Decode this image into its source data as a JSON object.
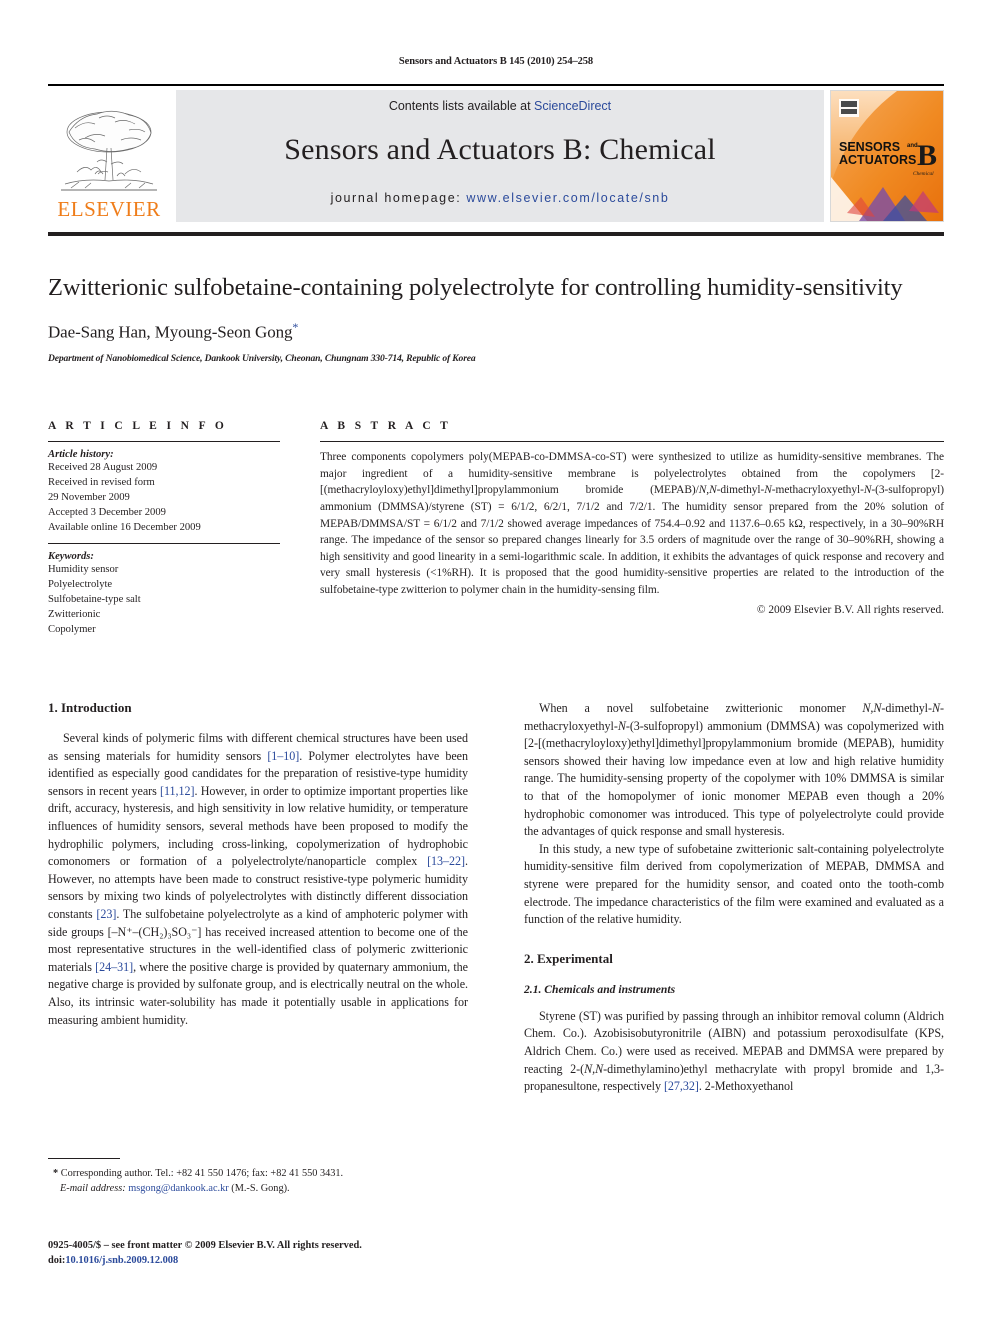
{
  "running_head": "Sensors and Actuators B 145 (2010) 254–258",
  "masthead": {
    "publisher_name": "ELSEVIER",
    "contents_prefix": "Contents lists available at ",
    "contents_link": "ScienceDirect",
    "journal_title": "Sensors and Actuators B: Chemical",
    "homepage_prefix": "journal homepage: ",
    "homepage_url": "www.elsevier.com/locate/snb",
    "cover": {
      "line1": "SENSORS",
      "line1_small": "and",
      "line2": "ACTUATORS",
      "letter": "B",
      "sublabel": "Chemical"
    }
  },
  "article": {
    "title": "Zwitterionic sulfobetaine-containing polyelectrolyte for controlling humidity-sensitivity",
    "authors": "Dae-Sang Han, Myoung-Seon Gong",
    "corresponding_marker": "*",
    "affiliation": "Department of Nanobiomedical Science, Dankook University, Cheonan, Chungnam 330-714, Republic of Korea"
  },
  "article_info": {
    "heading": "A R T I C L E    I N F O",
    "history_label": "Article history:",
    "history": [
      "Received 28 August 2009",
      "Received in revised form",
      "29 November 2009",
      "Accepted 3 December 2009",
      "Available online 16 December 2009"
    ],
    "keywords_label": "Keywords:",
    "keywords": [
      "Humidity sensor",
      "Polyelectrolyte",
      "Sulfobetaine-type salt",
      "Zwitterionic",
      "Copolymer"
    ]
  },
  "abstract": {
    "heading": "A B S T R A C T",
    "text_part1": "Three components copolymers poly(MEPAB-co-DMMSA-co-ST) were synthesized to utilize as humidity-sensitive membranes. The major ingredient of a humidity-sensitive membrane is polyelectrolytes obtained from the copolymers [2-[(methacryloyloxy)ethyl]dimethyl]propylammonium bromide (MEPAB)/",
    "text_italic1": "N,N",
    "text_part2": "-dimethyl-",
    "text_italic2": "N",
    "text_part3": "-methacryloxyethyl-",
    "text_italic3": "N",
    "text_part4": "-(3-sulfopropyl) ammonium (DMMSA)/styrene (ST) = 6/1/2, 6/2/1, 7/1/2 and 7/2/1. The humidity sensor prepared from the 20% solution of MEPAB/DMMSA/ST = 6/1/2 and 7/1/2 showed average impedances of 754.4–0.92 and 1137.6–0.65 kΩ, respectively, in a 30–90%RH range. The impedance of the sensor so prepared changes linearly for 3.5 orders of magnitude over the range of 30–90%RH, showing a high sensitivity and good linearity in a semi-logarithmic scale. In addition, it exhibits the advantages of quick response and recovery and very small hysteresis (<1%RH). It is proposed that the good humidity-sensitive properties are related to the introduction of the sulfobetaine-type zwitterion to polymer chain in the humidity-sensing film.",
    "copyright": "© 2009 Elsevier B.V. All rights reserved."
  },
  "sections": {
    "introduction_heading": "1.  Introduction",
    "intro_p1_a": "Several kinds of polymeric films with different chemical structures have been used as sensing materials for humidity sensors ",
    "intro_ref1": "[1–10]",
    "intro_p1_b": ". Polymer electrolytes have been identified as especially good candidates for the preparation of resistive-type humidity sensors in recent years ",
    "intro_ref2": "[11,12]",
    "intro_p1_c": ". However, in order to optimize important properties like drift, accuracy, hysteresis, and high sensitivity in low relative humidity, or temperature influences of humidity sensors, several methods have been proposed to modify the hydrophilic polymers, including cross-linking, copolymerization of hydrophobic comonomers or formation of a polyelectrolyte/nanoparticle complex ",
    "intro_ref3": "[13–22]",
    "intro_p1_d": ". However, no attempts have been made to construct resistive-type polymeric humidity sensors by mixing two kinds of polyelectrolytes with distinctly different dissociation constants ",
    "intro_ref4": "[23]",
    "intro_p1_e": ". The sulfobetaine polyelectrolyte as a kind of amphoteric polymer with side groups [–N⁺–(CH₂)₃SO₃⁻] has received increased attention to become one of the most representative structures in the well-identified class of polymeric zwitterionic materials ",
    "intro_ref5": "[24–31]",
    "intro_p1_f": ", where the positive charge is provided by quaternary ammonium, the negative charge is provided by sulfonate group, and is electrically neutral on the whole. Also, its intrinsic water-solubility has made it potentially usable in applications for measuring ambient humidity.",
    "right_p1_a": "When a novel sulfobetaine zwitterionic monomer ",
    "right_p1_i1": "N,N",
    "right_p1_b": "-dimethyl-",
    "right_p1_i2": "N",
    "right_p1_c": "-methacryloxyethyl-",
    "right_p1_i3": "N",
    "right_p1_d": "-(3-sulfopropyl) ammonium (DMMSA) was copolymerized with [2-[(methacryloyloxy)ethyl]dimethyl]propylammonium bromide (MEPAB), humidity sensors showed their having low impedance even at low and high relative humidity range. The humidity-sensing property of the copolymer with 10% DMMSA is similar to that of the homopolymer of ionic monomer MEPAB even though a 20% hydrophobic comonomer was introduced. This type of polyelectrolyte could provide the advantages of quick response and small hysteresis.",
    "right_p2": "In this study, a new type of sufobetaine zwitterionic salt-containing polyelectrolyte humidity-sensitive film derived from copolymerization of MEPAB, DMMSA and styrene were prepared for the humidity sensor, and coated onto the tooth-comb electrode. The impedance characteristics of the film were examined and evaluated as a function of the relative humidity.",
    "experimental_heading": "2.  Experimental",
    "chemicals_heading": "2.1.  Chemicals and instruments",
    "chem_p1_a": "Styrene (ST) was purified by passing through an inhibitor removal column (Aldrich Chem. Co.). Azobisisobutyronitrile (AIBN) and potassium peroxodisulfate (KPS, Aldrich Chem. Co.) were used as received. MEPAB and DMMSA were prepared by reacting 2-(",
    "chem_p1_i1": "N,N",
    "chem_p1_b": "-dimethylamino)ethyl methacrylate with propyl bromide and 1,3-propanesultone, respectively ",
    "chem_ref1": "[27,32]",
    "chem_p1_c": ". 2-Methoxyethanol"
  },
  "footnote": {
    "marker": "*",
    "corresponding": " Corresponding author. Tel.: +82 41 550 1476; fax: +82 41 550 3431.",
    "email_label": "E-mail address:",
    "email": "msgong@dankook.ac.kr",
    "email_suffix": " (M.-S. Gong).",
    "issn_line": "0925-4005/$ – see front matter © 2009 Elsevier B.V. All rights reserved.",
    "doi_label": "doi:",
    "doi": "10.1016/j.snb.2009.12.008"
  },
  "colors": {
    "link": "#2b4a9b",
    "elsevier_orange": "#ef7d1a",
    "band_gray": "#e6e7e9",
    "text": "#231f20"
  }
}
